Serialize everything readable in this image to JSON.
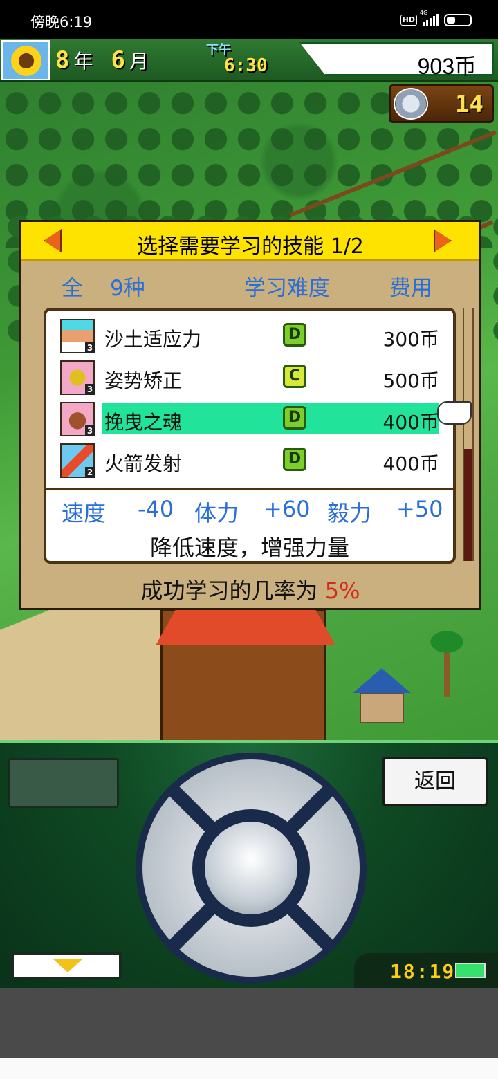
{
  "status_bar": {
    "time": "傍晚6:19",
    "hd": "HD",
    "network": "4G"
  },
  "top_bar": {
    "year_num": "8",
    "year_unit": "年",
    "month_num": "6",
    "month_unit": "月",
    "ampm": "下午",
    "clock": "6:30",
    "money": "903币",
    "horseshoe_count": "14"
  },
  "dialog": {
    "title": "选择需要学习的技能 1/2",
    "header_all": "全",
    "header_count": "9种",
    "header_difficulty": "学习难度",
    "header_cost": "费用",
    "skills": [
      {
        "name": "沙土适应力",
        "grade": "D",
        "price": "300币",
        "level": "3"
      },
      {
        "name": "姿势矫正",
        "grade": "C",
        "price": "500币",
        "level": "3"
      },
      {
        "name": "挽曳之魂",
        "grade": "D",
        "price": "400币",
        "level": "3"
      },
      {
        "name": "火箭发射",
        "grade": "D",
        "price": "400币",
        "level": "2"
      }
    ],
    "stats": {
      "speed_label": "速度",
      "speed_value": "-40",
      "stamina_label": "体力",
      "stamina_value": "+60",
      "grit_label": "毅力",
      "grit_value": "+50"
    },
    "description": "降低速度，增强力量",
    "probability_text": "成功学习的几率为",
    "probability_value": "5%"
  },
  "controller": {
    "back_label": "返回",
    "clock": "18:19"
  }
}
